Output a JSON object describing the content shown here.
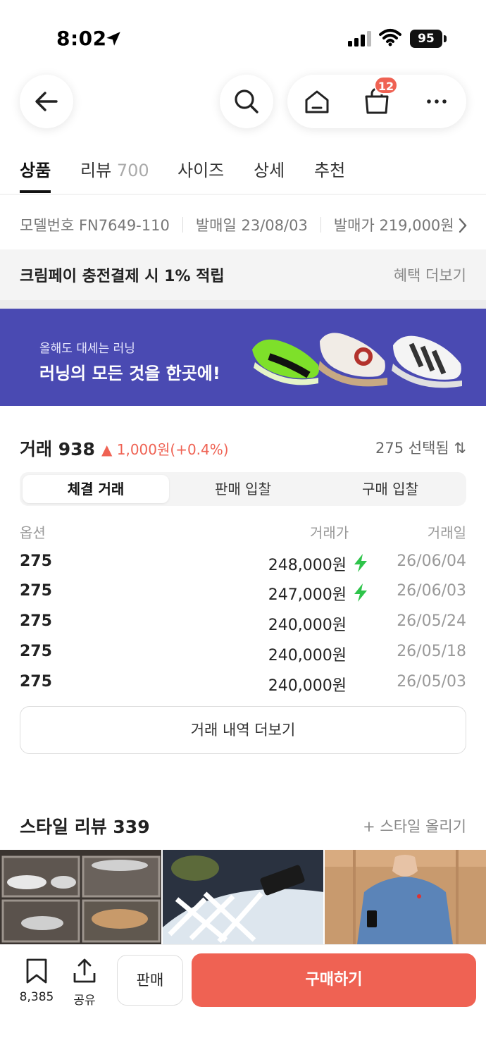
{
  "status_bar": {
    "time": "8:02",
    "battery": "95"
  },
  "nav": {
    "cart_count": "12"
  },
  "tabs": [
    {
      "label": "상품",
      "count": ""
    },
    {
      "label": "리뷰",
      "count": "700"
    },
    {
      "label": "사이즈",
      "count": ""
    },
    {
      "label": "상세",
      "count": ""
    },
    {
      "label": "추천",
      "count": ""
    }
  ],
  "info": {
    "model": "모델번호 FN7649-110",
    "release_date": "발매일 23/08/03",
    "release_price": "발매가 219,000원"
  },
  "benefit": {
    "text": "크림페이 충전결제 시 1% 적립",
    "more": "혜택 더보기"
  },
  "banner": {
    "subtitle": "올해도 대세는 러닝",
    "title": "러닝의 모든 것을 한곳에!"
  },
  "trades": {
    "title": "거래 938",
    "change": "▲ 1,000원(+0.4%)",
    "selected": "275 선택됨 ⇅",
    "segments": [
      "체결 거래",
      "판매 입찰",
      "구매 입찰"
    ],
    "columns": {
      "option": "옵션",
      "price": "거래가",
      "date": "거래일"
    },
    "rows": [
      {
        "option": "275",
        "price": "248,000원",
        "fast": true,
        "date": "26/06/04"
      },
      {
        "option": "275",
        "price": "247,000원",
        "fast": true,
        "date": "26/06/03"
      },
      {
        "option": "275",
        "price": "240,000원",
        "fast": false,
        "date": "26/05/24"
      },
      {
        "option": "275",
        "price": "240,000원",
        "fast": false,
        "date": "26/05/18"
      },
      {
        "option": "275",
        "price": "240,000원",
        "fast": false,
        "date": "26/05/03"
      }
    ],
    "more_label": "거래 내역 더보기"
  },
  "style_review": {
    "title": "스타일 리뷰 339",
    "upload": "+ 스타일 올리기"
  },
  "bottom_bar": {
    "bookmark_count": "8,385",
    "share_label": "공유",
    "sell_label": "판매",
    "buy_label": "구매하기"
  },
  "colors": {
    "accent": "#ef6253",
    "banner": "#4a4ab2",
    "fast_delivery": "#2ec44a"
  },
  "icons": [
    "back-arrow-icon",
    "search-icon",
    "home-icon",
    "cart-icon",
    "more-icon",
    "chevron-right-icon",
    "bolt-icon",
    "bookmark-icon",
    "share-icon",
    "location-arrow-icon",
    "signal-icon",
    "wifi-icon"
  ]
}
